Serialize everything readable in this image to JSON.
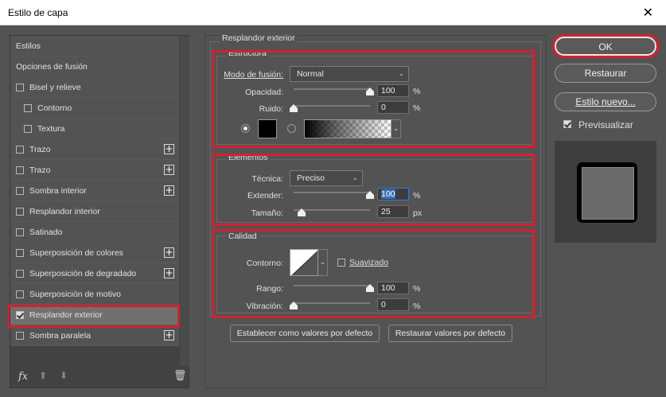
{
  "window": {
    "title": "Estilo de capa",
    "close_glyph": "✕"
  },
  "left_panel": {
    "items": [
      {
        "label": "Estilos",
        "type": "header",
        "checked": false,
        "has_plus": false
      },
      {
        "label": "Opciones de fusión",
        "type": "header",
        "checked": false,
        "has_plus": false
      },
      {
        "label": "Bisel y relieve",
        "type": "check",
        "checked": false,
        "has_plus": false
      },
      {
        "label": "Contorno",
        "type": "sub",
        "checked": false,
        "has_plus": false
      },
      {
        "label": "Textura",
        "type": "sub",
        "checked": false,
        "has_plus": false
      },
      {
        "label": "Trazo",
        "type": "check",
        "checked": false,
        "has_plus": true
      },
      {
        "label": "Trazo",
        "type": "check",
        "checked": false,
        "has_plus": true
      },
      {
        "label": "Sombra interior",
        "type": "check",
        "checked": false,
        "has_plus": true
      },
      {
        "label": "Resplandor interior",
        "type": "check",
        "checked": false,
        "has_plus": false
      },
      {
        "label": "Satinado",
        "type": "check",
        "checked": false,
        "has_plus": false
      },
      {
        "label": "Superposición de colores",
        "type": "check",
        "checked": false,
        "has_plus": true
      },
      {
        "label": "Superposición de degradado",
        "type": "check",
        "checked": false,
        "has_plus": true
      },
      {
        "label": "Superposición de motivo",
        "type": "check",
        "checked": false,
        "has_plus": false
      },
      {
        "label": "Resplandor exterior",
        "type": "check",
        "checked": true,
        "has_plus": false,
        "selected": true
      },
      {
        "label": "Sombra paralela",
        "type": "check",
        "checked": false,
        "has_plus": true
      }
    ],
    "plus_glyph": "+",
    "bottom": {
      "fx_label": "fx",
      "up_glyph": "⬆",
      "down_glyph": "⬇",
      "trash_glyph": "🗑"
    }
  },
  "outer_glow": {
    "title": "Resplandor exterior",
    "structure": {
      "title": "Estructura",
      "blend_mode_label": "Modo de fusión:",
      "blend_mode_value": "Normal",
      "opacity_label": "Opacidad:",
      "opacity_value": "100",
      "opacity_fraction": 1.0,
      "noise_label": "Ruido:",
      "noise_value": "0",
      "noise_fraction": 0.0,
      "percent_unit": "%",
      "color_swatch": "#000000"
    },
    "elements": {
      "title": "Elementos",
      "technique_label": "Técnica:",
      "technique_value": "Preciso",
      "spread_label": "Extender:",
      "spread_value": "100",
      "spread_fraction": 1.0,
      "size_label": "Tamaño:",
      "size_value": "25",
      "size_fraction": 0.1,
      "percent_unit": "%",
      "px_unit": "px"
    },
    "quality": {
      "title": "Calidad",
      "contour_label": "Contorno:",
      "antialiased_label": "Suavizado",
      "antialiased_checked": false,
      "range_label": "Rango:",
      "range_value": "100",
      "range_fraction": 1.0,
      "jitter_label": "Vibración:",
      "jitter_value": "0",
      "jitter_fraction": 0.0,
      "percent_unit": "%"
    },
    "buttons": {
      "make_default": "Establecer como valores por defecto",
      "reset_default": "Restaurar valores por defecto"
    },
    "chevron_glyph": "⌄"
  },
  "right_panel": {
    "ok": "OK",
    "reset": "Restaurar",
    "new_style": "Estilo nuevo...",
    "preview_label": "Previsualizar",
    "preview_checked": true
  },
  "colors": {
    "highlight_red": "#d2212e",
    "panel_bg": "#535353",
    "list_bg": "#424242"
  }
}
